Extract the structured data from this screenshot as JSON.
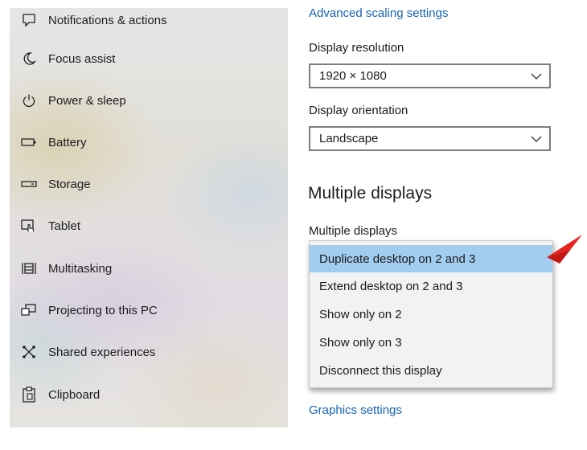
{
  "sidebar": {
    "items": [
      {
        "label": "Notifications & actions",
        "icon": "notification-icon"
      },
      {
        "label": "Focus assist",
        "icon": "moon-icon"
      },
      {
        "label": "Power & sleep",
        "icon": "power-icon"
      },
      {
        "label": "Battery",
        "icon": "battery-icon"
      },
      {
        "label": "Storage",
        "icon": "storage-icon"
      },
      {
        "label": "Tablet",
        "icon": "tablet-icon"
      },
      {
        "label": "Multitasking",
        "icon": "multitasking-icon"
      },
      {
        "label": "Projecting to this PC",
        "icon": "projecting-icon"
      },
      {
        "label": "Shared experiences",
        "icon": "shared-icon"
      },
      {
        "label": "Clipboard",
        "icon": "clipboard-icon"
      }
    ]
  },
  "main": {
    "advanced_scaling_link": "Advanced scaling settings",
    "resolution": {
      "label": "Display resolution",
      "value": "1920 × 1080"
    },
    "orientation": {
      "label": "Display orientation",
      "value": "Landscape"
    },
    "section_title": "Multiple displays",
    "multiple_displays": {
      "label": "Multiple displays",
      "options": [
        "Duplicate desktop on 2 and 3",
        "Extend desktop on 2 and 3",
        "Show only on 2",
        "Show only on 3",
        "Disconnect this display"
      ],
      "selected": "Duplicate desktop on 2 and 3"
    },
    "graphics_settings_link": "Graphics settings"
  },
  "colors": {
    "link": "#1764b6",
    "selected_option": "#a3cdef",
    "arrow": "#e8231f"
  }
}
